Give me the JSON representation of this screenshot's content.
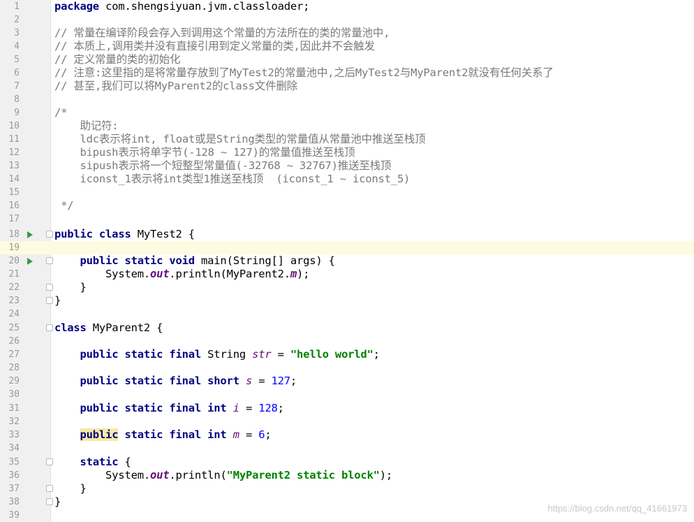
{
  "editor": {
    "line_numbers": [
      "1",
      "2",
      "3",
      "4",
      "5",
      "6",
      "7",
      "8",
      "9",
      "10",
      "11",
      "12",
      "13",
      "14",
      "15",
      "16",
      "17",
      "18",
      "19",
      "20",
      "21",
      "22",
      "23",
      "24",
      "25",
      "26",
      "27",
      "28",
      "29",
      "30",
      "31",
      "32",
      "33",
      "34",
      "35",
      "36",
      "37",
      "38",
      "39"
    ],
    "lines": {
      "l1": {
        "kw": "package",
        "rest": " com.shengsiyuan.jvm.classloader;"
      },
      "l3": "// 常量在编译阶段会存入到调用这个常量的方法所在的类的常量池中,",
      "l4": "// 本质上,调用类并没有直接引用到定义常量的类,因此并不会触发",
      "l5": "// 定义常量的类的初始化",
      "l6": "// 注意:这里指的是将常量存放到了MyTest2的常量池中,之后MyTest2与MyParent2就没有任何关系了",
      "l7": "// 甚至,我们可以将MyParent2的class文件删除",
      "l9": "/*",
      "l10": "    助记符:",
      "l11": "    ldc表示将int, float或是String类型的常量值从常量池中推送至栈顶",
      "l12": "    bipush表示将单字节(-128 ~ 127)的常量值推送至栈顶",
      "l13": "    sipush表示将一个短整型常量值(-32768 ~ 32767)推送至栈顶",
      "l14": "    iconst_1表示将int类型1推送至栈顶  (iconst_1 ~ iconst_5)",
      "l16": " */",
      "l18": {
        "kw": "public class",
        "rest": " MyTest2 {"
      },
      "l20": {
        "indent": "    ",
        "kw": "public static void",
        "rest": " main(String[] args) {"
      },
      "l21": {
        "a": "        System.",
        "field": "out",
        "b": ".println(MyParent2.",
        "field2": "m",
        "c": ");"
      },
      "l22": "    }",
      "l23": "}",
      "l25": {
        "kw": "class",
        "rest": " MyParent2 {"
      },
      "l27": {
        "indent": "    ",
        "kw": "public static final",
        "type": " String ",
        "name": "str",
        "eq": " = ",
        "val": "\"hello world\"",
        "end": ";"
      },
      "l29": {
        "indent": "    ",
        "kw": "public static final short",
        "sp": " ",
        "name": "s",
        "eq": " = ",
        "val": "127",
        "end": ";"
      },
      "l31": {
        "indent": "    ",
        "kw": "public static final int",
        "sp": " ",
        "name": "i",
        "eq": " = ",
        "val": "128",
        "end": ";"
      },
      "l33": {
        "indent": "    ",
        "kw1": "public",
        "kw2": " static final int",
        "sp": " ",
        "name": "m",
        "eq": " = ",
        "val": "6",
        "end": ";"
      },
      "l35": {
        "indent": "    ",
        "kw": "static",
        "rest": " {"
      },
      "l36": {
        "a": "        System.",
        "field": "out",
        "b": ".println(",
        "val": "\"MyParent2 static block\"",
        "c": ");"
      },
      "l37": "    }",
      "l38": "}"
    },
    "current_line": "19"
  },
  "watermark": "https://blog.csdn.net/qq_41661973",
  "colors": {
    "keyword": "#000080",
    "comment": "#7a7a7a",
    "string": "#008000",
    "number": "#0000ff",
    "field": "#660e7a",
    "run_marker": "#3d9a3d",
    "current_line_bg": "#fffbe0"
  }
}
